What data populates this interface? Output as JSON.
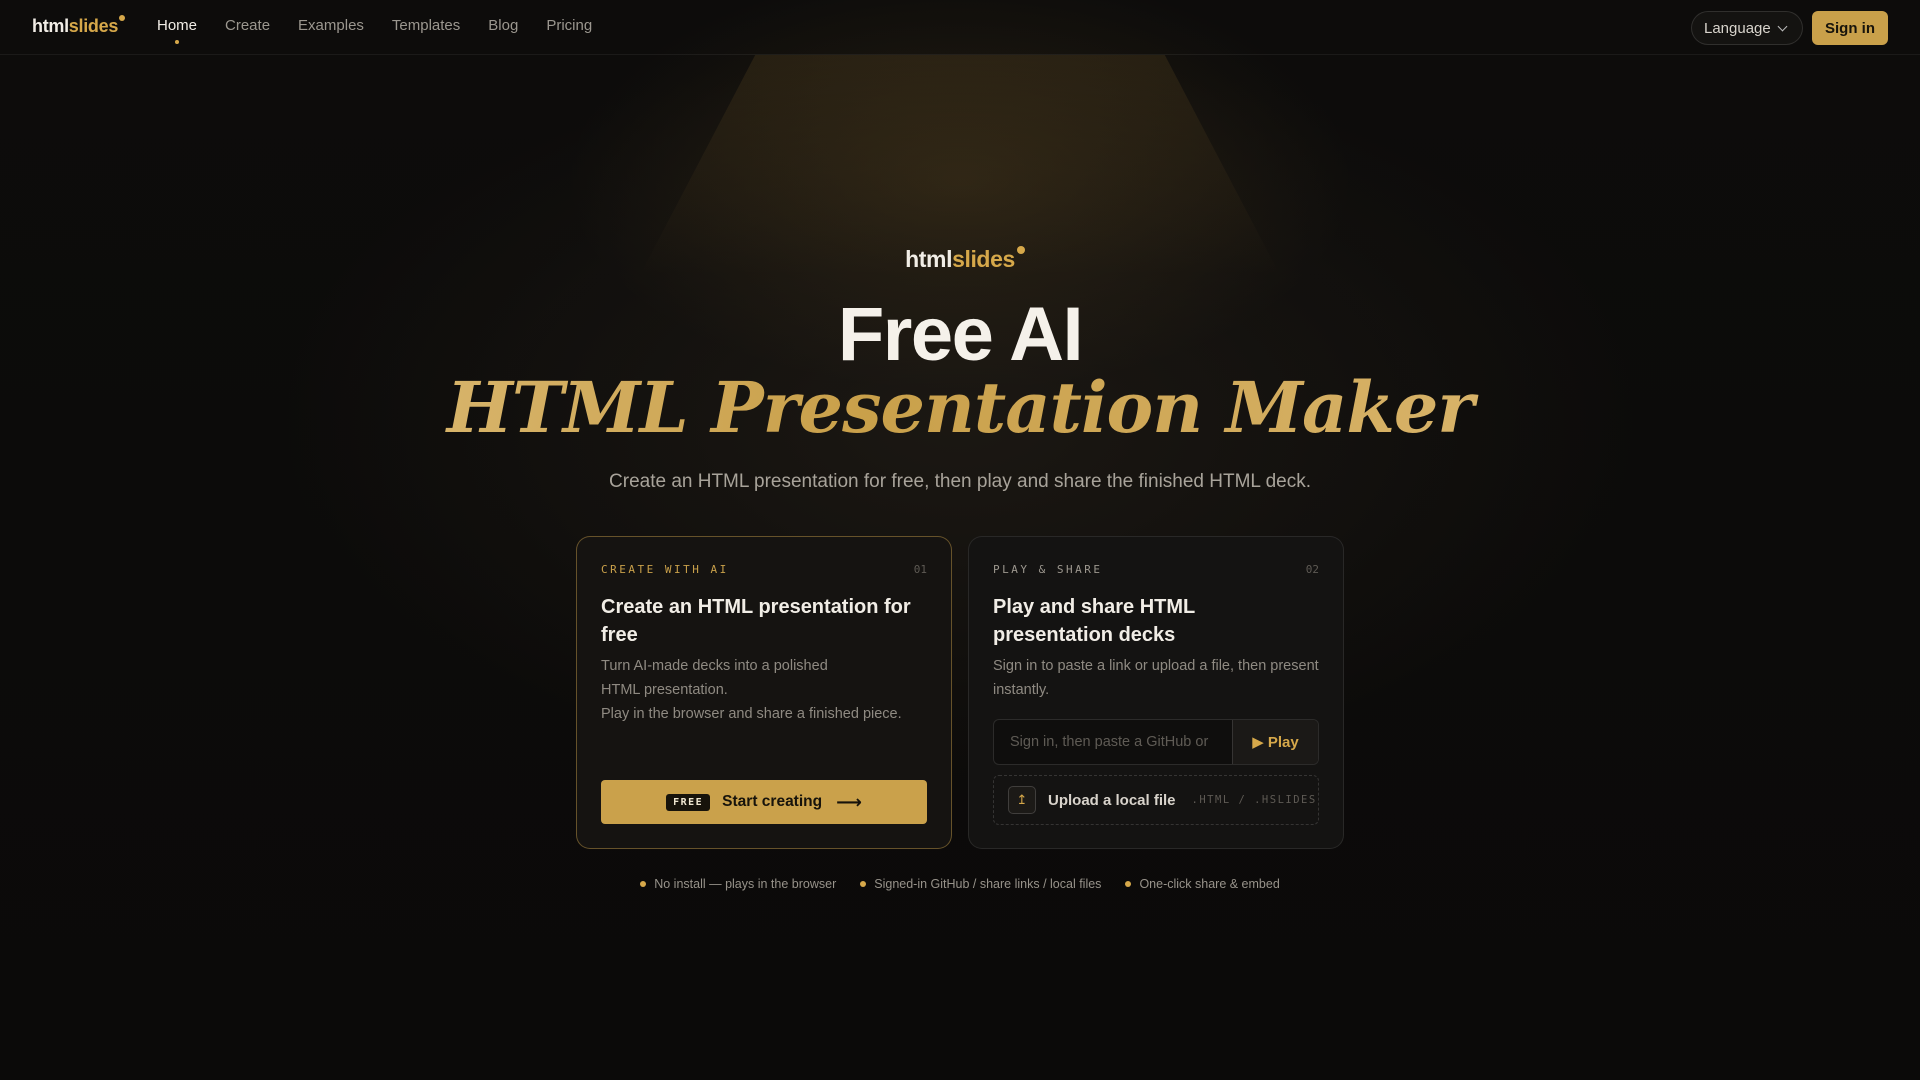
{
  "brand": {
    "prefix": "html",
    "suffix": "slides"
  },
  "nav": {
    "links": [
      "Home",
      "Create",
      "Examples",
      "Templates",
      "Blog",
      "Pricing"
    ],
    "active": "Home",
    "language_label": "Language",
    "signin_label": "Sign in"
  },
  "hero": {
    "title_line1": "Free AI",
    "title_line2": "HTML Presentation Maker",
    "subtitle": "Create an HTML presentation for free, then play and share the finished HTML deck."
  },
  "card_create": {
    "eyebrow": "CREATE WITH AI",
    "number": "01",
    "title": "Create an HTML presentation for free",
    "desc_lines": [
      "Turn AI-made decks into a polished",
      "HTML presentation.",
      "Play in the browser and share a finished piece."
    ],
    "badge": "FREE",
    "cta_label": "Start creating",
    "cta_arrow": "⟶"
  },
  "card_play": {
    "eyebrow": "PLAY & SHARE",
    "number": "02",
    "title": "Play and share HTML presentation decks",
    "desc": "Sign in to paste a link or upload a file, then present instantly.",
    "input_placeholder": "Sign in, then paste a GitHub or",
    "play_label": "Play",
    "upload_label": "Upload a local file",
    "upload_ext": ".HTML / .HSLIDES"
  },
  "features": [
    "No install — plays in the browser",
    "Signed-in GitHub / share links / local files",
    "One-click share & embed"
  ],
  "colors": {
    "accent": "#c9a04a",
    "background": "#0c0b0a",
    "card": "#141312"
  }
}
